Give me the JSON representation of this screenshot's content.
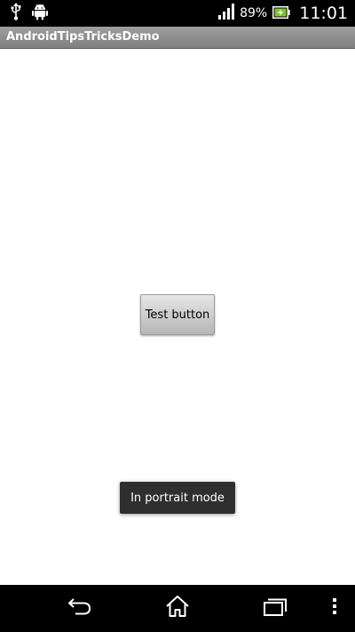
{
  "status_bar": {
    "battery_percent": "89%",
    "time": "11:01",
    "icons": [
      "usb-icon",
      "android-icon",
      "signal-icon",
      "battery-charging-icon"
    ]
  },
  "action_bar": {
    "title": "AndroidTipsTricksDemo"
  },
  "main": {
    "test_button_label": "Test button"
  },
  "toast": {
    "message": "In portrait mode"
  },
  "navigation_bar": {
    "icons": [
      "back-icon",
      "home-icon",
      "recent-apps-icon",
      "menu-icon"
    ]
  },
  "colors": {
    "status_bar": "#000000",
    "action_bar": "#8e8e8e",
    "battery_fill": "#7ec62f",
    "toast_background": "#2f2f2f"
  }
}
